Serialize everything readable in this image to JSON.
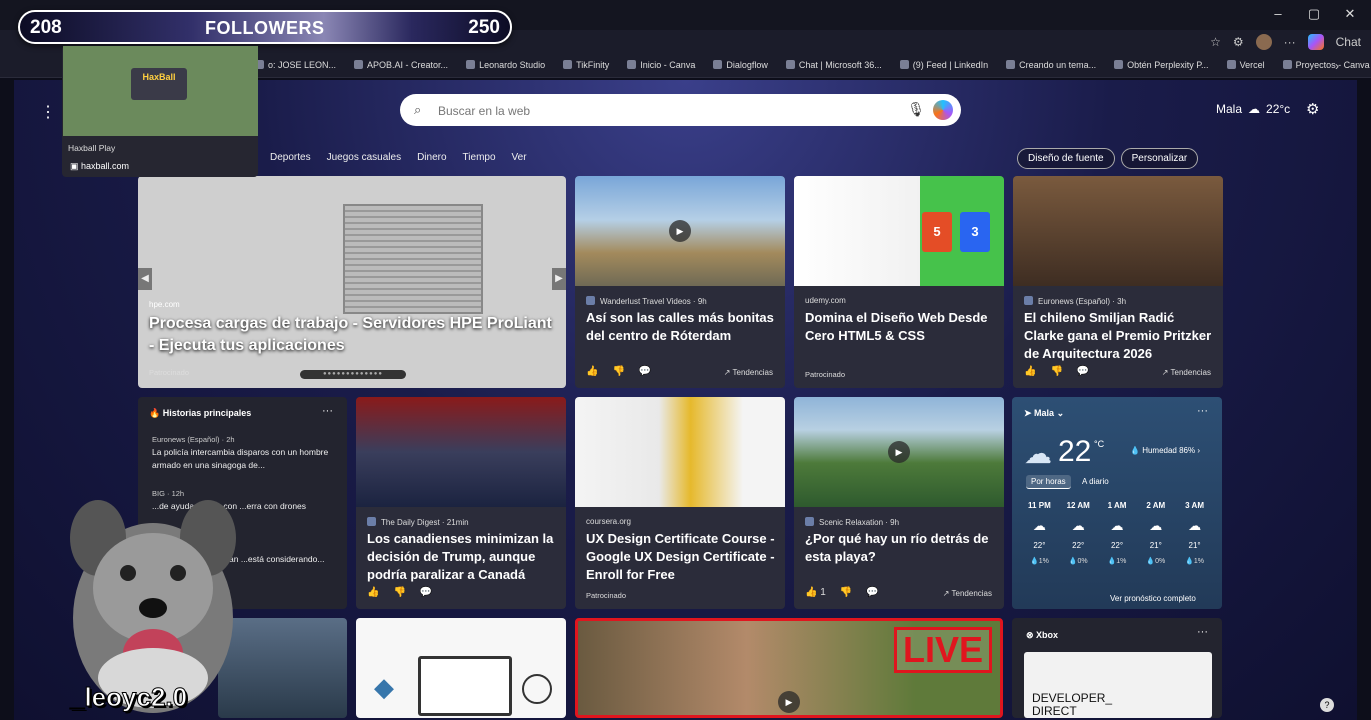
{
  "overlay": {
    "left_count": "208",
    "label": "FOLLOWERS",
    "right_count": "250",
    "handle": "_leoyc2.0"
  },
  "tab_preview": {
    "title": "Haxball Play",
    "url": "haxball.com",
    "logo_text": "HaxBall"
  },
  "window": {
    "minimize": "–",
    "maximize": "▢",
    "close": "✕"
  },
  "address_bar": {
    "chat_label": "Chat"
  },
  "favorites": [
    "o: JOSE LEON...",
    "APOB.AI - Creator...",
    "Leonardo Studio",
    "TikFinity",
    "Inicio - Canva",
    "Dialogflow",
    "Chat | Microsoft 36...",
    "(9) Feed | LinkedIn",
    "Creando un tema...",
    "Obtén Perplexity P...",
    "Vercel",
    "Proyectos - Canva"
  ],
  "search": {
    "placeholder": "Buscar en la web"
  },
  "weather_top": {
    "location": "Mala",
    "temp": "22°c"
  },
  "nav": [
    "Deportes",
    "Juegos casuales",
    "Dinero",
    "Tiempo",
    "Ver"
  ],
  "nav_buttons": {
    "font": "Diseño de fuente",
    "personalize": "Personalizar"
  },
  "cards": {
    "hero": {
      "source": "hpe.com",
      "title": "Procesa cargas de trabajo - Servidores HPE ProLiant - Ejecuta tus aplicaciones",
      "sponsored": "Patrocinado"
    },
    "c1": {
      "source": "Wanderlust Travel Videos · 9h",
      "title": "Así son las calles más bonitas del centro de Róterdam",
      "trend": "Tendencias"
    },
    "c2": {
      "source": "udemy.com",
      "title": "Domina el Diseño Web Desde Cero HTML5 & CSS",
      "sponsored": "Patrocinado"
    },
    "c3": {
      "source": "Euronews (Español) · 3h",
      "title": "El chileno Smiljan Radić Clarke gana el Premio Pritzker de Arquitectura 2026",
      "trend": "Tendencias"
    },
    "c4": {
      "source": "The Daily Digest · 21min",
      "title": "Los canadienses minimizan la decisión de Trump, aunque podría paralizar a Canadá"
    },
    "c5": {
      "source": "coursera.org",
      "title": "UX Design Certificate Course - Google UX Design Certificate - Enroll for Free",
      "sponsored": "Patrocinado"
    },
    "c6": {
      "source": "Scenic Relaxation · 9h",
      "title": "¿Por qué hay un río detrás de esta playa?",
      "likes": "1",
      "trend": "Tendencias"
    }
  },
  "stories": {
    "header": "Historias principales",
    "items": [
      {
        "source": "Euronews (Español) · 2h",
        "text": "La policía intercambia disparos con un hombre armado en una sinagoga de..."
      },
      {
        "source": "BIG · 12h",
        "text": "...de ayudar a Irán con ...erra con drones"
      },
      {
        "source": "· 5h",
        "text": "Los aranceles eran tan ...está considerando..."
      }
    ]
  },
  "weather_card": {
    "location": "Mala",
    "temp": "22",
    "unit": "°C",
    "humidity": "Humedad 86%",
    "tab_hourly": "Por horas",
    "tab_daily": "A diario",
    "hours": [
      {
        "time": "11 PM",
        "temp": "22°",
        "rain": "1%"
      },
      {
        "time": "12 AM",
        "temp": "22°",
        "rain": "0%"
      },
      {
        "time": "1 AM",
        "temp": "22°",
        "rain": "1%"
      },
      {
        "time": "2 AM",
        "temp": "21°",
        "rain": "0%"
      },
      {
        "time": "3 AM",
        "temp": "21°",
        "rain": "1%"
      }
    ],
    "link": "Ver pronóstico completo"
  },
  "xbox": {
    "header": "Xbox",
    "banner_text": "DEVELOPER_ DIRECT"
  },
  "live_label": "LIVE",
  "colors": {
    "accent_live": "#e0151e",
    "card_bg": "#2b2c3a"
  }
}
